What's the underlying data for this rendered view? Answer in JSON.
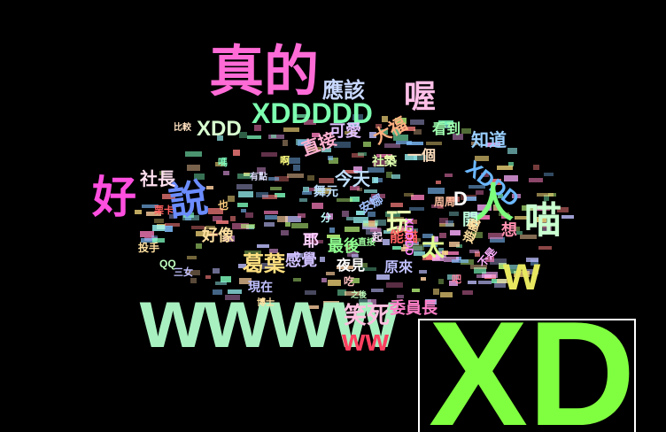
{
  "words": [
    {
      "text": "真的",
      "color": "#ff6bd6"
    },
    {
      "text": "wwww",
      "color": "#a8f0c0"
    },
    {
      "text": "XDDDDD",
      "color": "#7dffb0"
    },
    {
      "text": "好",
      "color": "#ff4fe0"
    },
    {
      "text": "說",
      "color": "#6b8cff"
    },
    {
      "text": "喔",
      "color": "#ffc0e8"
    },
    {
      "text": "應該",
      "color": "#c8d8ff"
    },
    {
      "text": "XDD",
      "color": "#d8ffd0"
    },
    {
      "text": "喵",
      "color": "#c8ffd0"
    },
    {
      "text": "w",
      "color": "#e8e860"
    },
    {
      "text": "XDDD",
      "color": "#6bb8ff"
    },
    {
      "text": "人",
      "color": "#7dff7d"
    },
    {
      "text": "ww",
      "color": "#ff4060"
    },
    {
      "text": "笑死",
      "color": "#ffc0e0"
    },
    {
      "text": "委員長",
      "color": "#ff80c8"
    },
    {
      "text": "葛葉",
      "color": "#ffe080"
    },
    {
      "text": "社長",
      "color": "#ffe0f0"
    },
    {
      "text": "知道",
      "color": "#9ad0ff"
    },
    {
      "text": "今天",
      "color": "#c0e0ff"
    },
    {
      "text": "玩",
      "color": "#e8ffb0"
    },
    {
      "text": "好像",
      "color": "#ffe0a0"
    },
    {
      "text": "太",
      "color": "#e0ff90"
    },
    {
      "text": "直接",
      "color": "#ffb0d0"
    },
    {
      "text": "可愛",
      "color": "#e0c0ff"
    },
    {
      "text": "大福",
      "color": "#ffb080"
    },
    {
      "text": "感覺",
      "color": "#d0c0ff"
    },
    {
      "text": "最後",
      "color": "#90ff90"
    },
    {
      "text": "耶",
      "color": "#ffd0ff"
    },
    {
      "text": "夜見",
      "color": "#ffffff"
    },
    {
      "text": "能貓",
      "color": "#ff6060"
    },
    {
      "text": "原來",
      "color": "#c0c0ff"
    },
    {
      "text": "XDDDD",
      "color": "#ff80ff"
    },
    {
      "text": "D",
      "color": "#ffffff"
    },
    {
      "text": "想",
      "color": "#ff90b0"
    },
    {
      "text": "看到",
      "color": "#a0ffb0"
    },
    {
      "text": "一個",
      "color": "#ffe0c0"
    },
    {
      "text": "開",
      "color": "#c0ffe0"
    },
    {
      "text": "現在",
      "color": "#c0c0ff"
    },
    {
      "text": "舞元",
      "color": "#c0e0ff"
    },
    {
      "text": "安娜",
      "color": "#a0c0ff"
    },
    {
      "text": "遊戲",
      "color": "#ffe0a0"
    },
    {
      "text": "社築",
      "color": "#e0ffb0"
    },
    {
      "text": "周周",
      "color": "#ffc0a0"
    },
    {
      "text": "比較",
      "color": "#ffe0c0"
    },
    {
      "text": "栗卡",
      "color": "#ff6060"
    },
    {
      "text": "QQ",
      "color": "#c0ffc0"
    },
    {
      "text": "三女",
      "color": "#c0c0ff"
    },
    {
      "text": "投手",
      "color": "#ffe0a0"
    },
    {
      "text": "直接",
      "color": "#a0ffa0"
    },
    {
      "text": "也",
      "color": "#ffd080"
    },
    {
      "text": "不是",
      "color": "#ffb0ff"
    },
    {
      "text": "博士",
      "color": "#ffe0a0"
    },
    {
      "text": "有點",
      "color": "#e0e0ff"
    },
    {
      "text": "之後",
      "color": "#c0ffc0"
    },
    {
      "text": "吃",
      "color": "#ffc0c0"
    },
    {
      "text": "分",
      "color": "#c0ffff"
    },
    {
      "text": "起",
      "color": "#ffe0ff"
    },
    {
      "text": "啊",
      "color": "#ffff80"
    },
    {
      "text": "嗎",
      "color": "#80ffc0"
    },
    {
      "text": "吧",
      "color": "#ff80a0"
    },
    {
      "text": "XD",
      "color": "#80ff40"
    }
  ],
  "highlight": {
    "text": "XD",
    "color": "#80ff40"
  }
}
